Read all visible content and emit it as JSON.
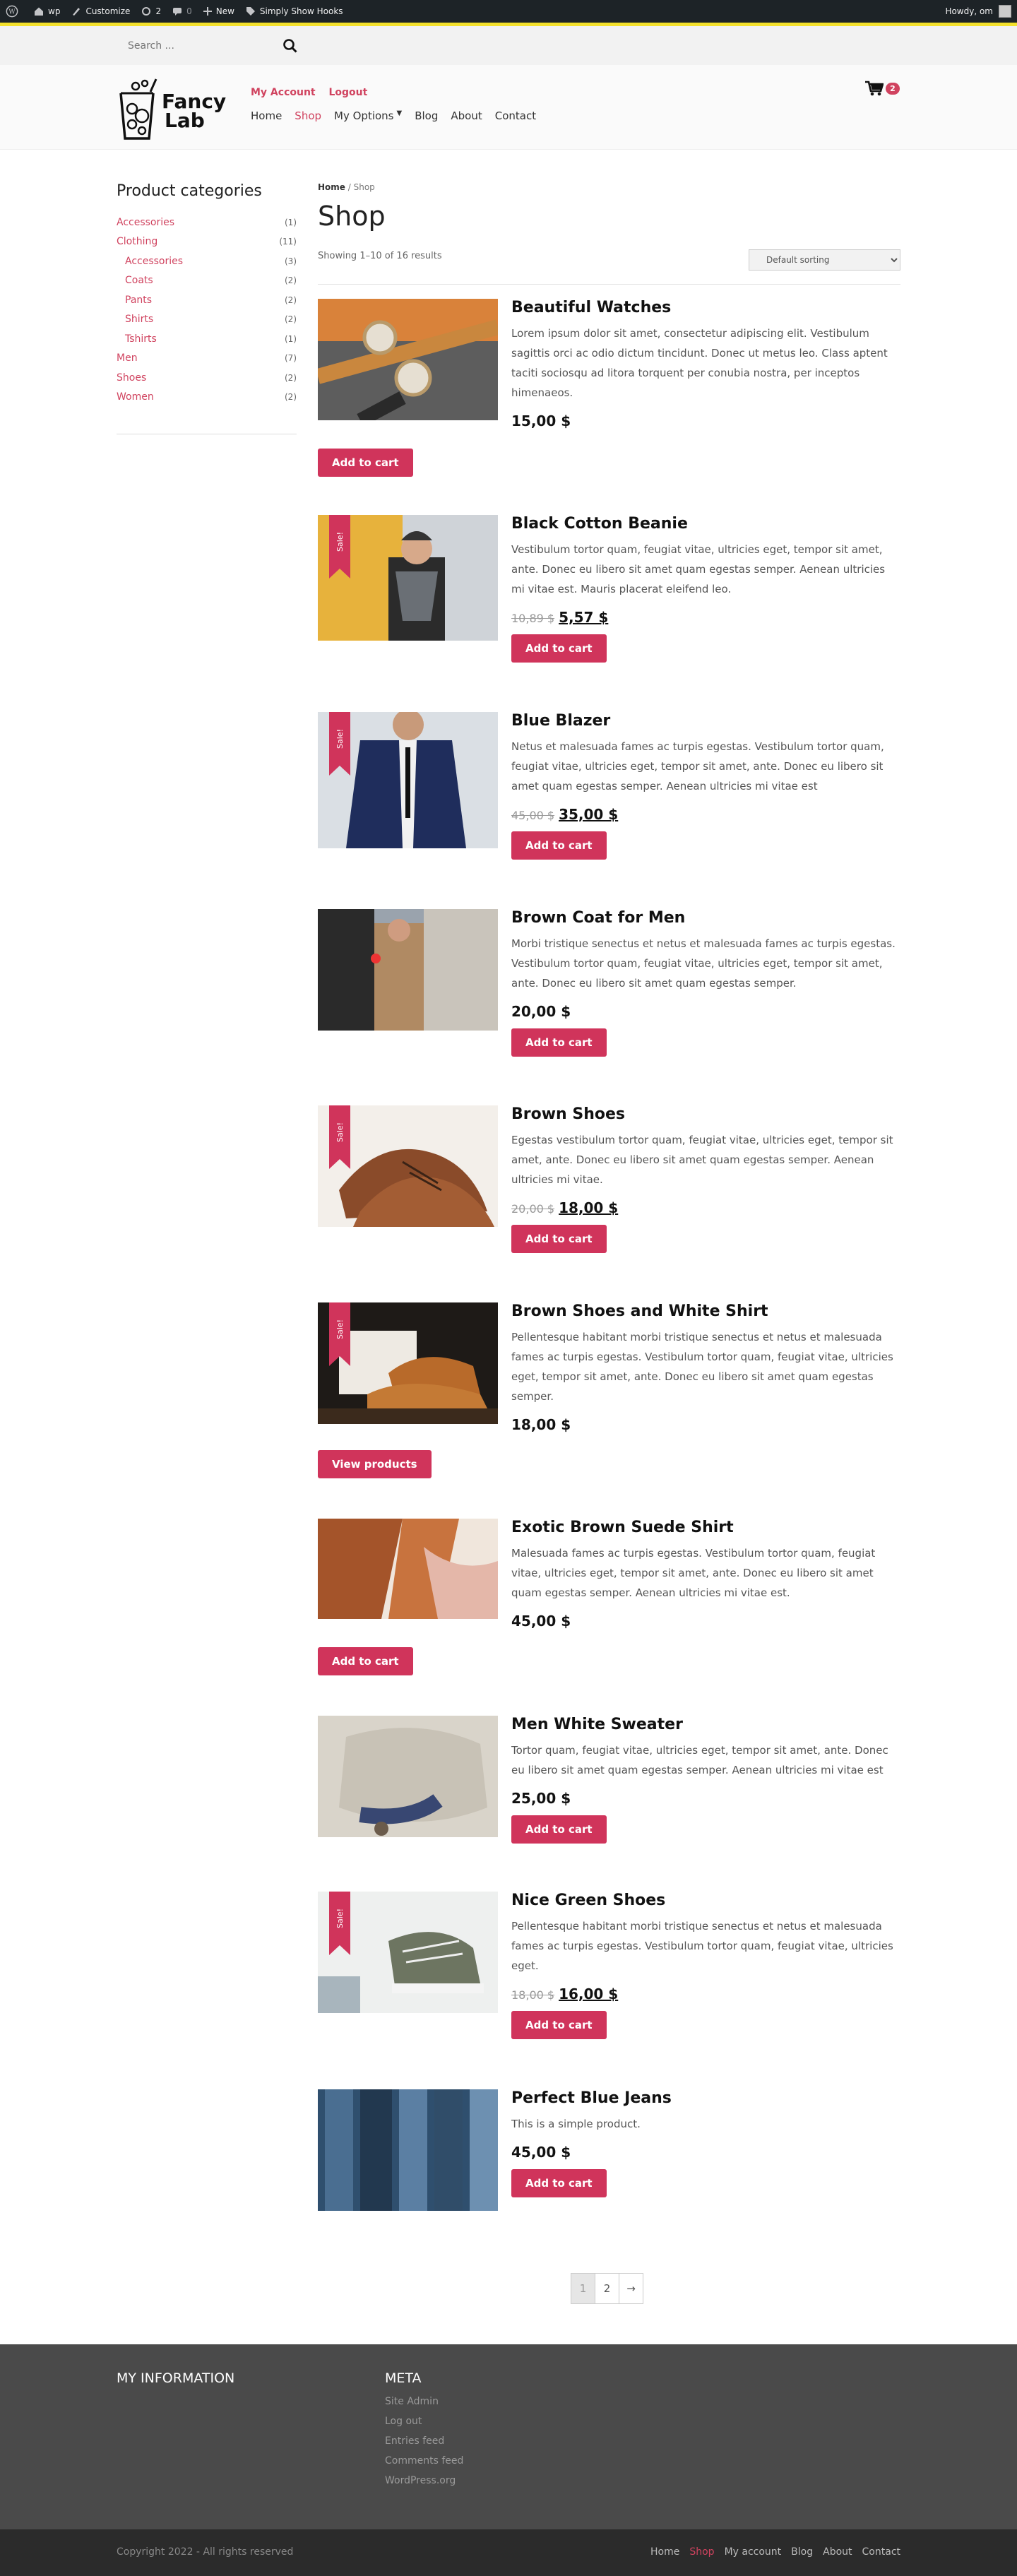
{
  "adminbar": {
    "site": "wp",
    "customize": "Customize",
    "updates": "2",
    "comments": "0",
    "new": "New",
    "plugin": "Simply Show Hooks",
    "howdy": "Howdy, om"
  },
  "search": {
    "placeholder": "Search ..."
  },
  "header": {
    "logo_line1": "Fancy",
    "logo_line2": "Lab",
    "my_account": "My Account",
    "logout": "Logout",
    "cart_count": "2",
    "nav": [
      "Home",
      "Shop",
      "My Options",
      "Blog",
      "About",
      "Contact"
    ],
    "active_nav": "Shop"
  },
  "sidebar": {
    "title": "Product categories",
    "categories": [
      {
        "name": "Accessories",
        "count": "(1)",
        "sub": false
      },
      {
        "name": "Clothing",
        "count": "(11)",
        "sub": false
      },
      {
        "name": "Accessories",
        "count": "(3)",
        "sub": true
      },
      {
        "name": "Coats",
        "count": "(2)",
        "sub": true
      },
      {
        "name": "Pants",
        "count": "(2)",
        "sub": true
      },
      {
        "name": "Shirts",
        "count": "(2)",
        "sub": true
      },
      {
        "name": "Tshirts",
        "count": "(1)",
        "sub": true
      },
      {
        "name": "Men",
        "count": "(7)",
        "sub": false
      },
      {
        "name": "Shoes",
        "count": "(2)",
        "sub": false
      },
      {
        "name": "Women",
        "count": "(2)",
        "sub": false
      }
    ]
  },
  "main": {
    "breadcrumb_home": "Home",
    "breadcrumb_sep": " / ",
    "breadcrumb_current": "Shop",
    "title": "Shop",
    "result_count": "Showing 1–10 of 16 results",
    "sort_selected": "Default sorting"
  },
  "products": [
    {
      "title": "Beautiful Watches",
      "desc": "Lorem ipsum dolor sit amet, consectetur adipiscing elit. Vestibulum sagittis orci ac odio dictum tincidunt. Donec ut metus leo. Class aptent taciti sociosqu ad litora torquent per conubia nostra, per inceptos himenaeos.",
      "old_price": "",
      "price": "15,00 $",
      "sale": false,
      "button": "Add to cart"
    },
    {
      "title": "Black Cotton Beanie",
      "desc": "Vestibulum tortor quam, feugiat vitae, ultricies eget, tempor sit amet, ante. Donec eu libero sit amet quam egestas semper. Aenean ultricies mi vitae est. Mauris placerat eleifend leo.",
      "old_price": "10,89 $",
      "price": "5,57 $",
      "sale": true,
      "button": "Add to cart"
    },
    {
      "title": "Blue Blazer",
      "desc": "Netus et malesuada fames ac turpis egestas. Vestibulum tortor quam, feugiat vitae, ultricies eget, tempor sit amet, ante. Donec eu libero sit amet quam egestas semper. Aenean ultricies mi vitae est",
      "old_price": "45,00 $",
      "price": "35,00 $",
      "sale": true,
      "button": "Add to cart"
    },
    {
      "title": "Brown Coat for Men",
      "desc": "Morbi tristique senectus et netus et malesuada fames ac turpis egestas. Vestibulum tortor quam, feugiat vitae, ultricies eget, tempor sit amet, ante. Donec eu libero sit amet quam egestas semper.",
      "old_price": "",
      "price": "20,00 $",
      "sale": false,
      "button": "Add to cart"
    },
    {
      "title": "Brown Shoes",
      "desc": "Egestas vestibulum tortor quam, feugiat vitae, ultricies eget, tempor sit amet, ante. Donec eu libero sit amet quam egestas semper. Aenean ultricies mi vitae.",
      "old_price": "20,00 $",
      "price": "18,00 $",
      "sale": true,
      "button": "Add to cart"
    },
    {
      "title": "Brown Shoes and White Shirt",
      "desc": "Pellentesque habitant morbi tristique senectus et netus et malesuada fames ac turpis egestas. Vestibulum tortor quam, feugiat vitae, ultricies eget, tempor sit amet, ante. Donec eu libero sit amet quam egestas semper.",
      "old_price": "",
      "price": "18,00 $",
      "sale": true,
      "button": "View products"
    },
    {
      "title": "Exotic Brown Suede Shirt",
      "desc": "Malesuada fames ac turpis egestas. Vestibulum tortor quam, feugiat vitae, ultricies eget, tempor sit amet, ante. Donec eu libero sit amet quam egestas semper. Aenean ultricies mi vitae est.",
      "old_price": "",
      "price": "45,00 $",
      "sale": false,
      "button": "Add to cart"
    },
    {
      "title": "Men White Sweater",
      "desc": "Tortor quam, feugiat vitae, ultricies eget, tempor sit amet, ante. Donec eu libero sit amet quam egestas semper. Aenean ultricies mi vitae est",
      "old_price": "",
      "price": "25,00 $",
      "sale": false,
      "button": "Add to cart"
    },
    {
      "title": "Nice Green Shoes",
      "desc": "Pellentesque habitant morbi tristique senectus et netus et malesuada fames ac turpis egestas. Vestibulum tortor quam, feugiat vitae, ultricies eget.",
      "old_price": "18,00 $",
      "price": "16,00 $",
      "sale": true,
      "button": "Add to cart"
    },
    {
      "title": "Perfect Blue Jeans",
      "desc": "This is a simple product.",
      "old_price": "",
      "price": "45,00 $",
      "sale": false,
      "button": "Add to cart"
    }
  ],
  "sale_label": "Sale!",
  "pagination": {
    "current": "1",
    "next": "2",
    "arrow": "→"
  },
  "footer": {
    "col1_title": "MY INFORMATION",
    "col2_title": "META",
    "meta_links": [
      "Site Admin",
      "Log out",
      "Entries feed",
      "Comments feed",
      "WordPress.org"
    ],
    "copyright": "Copyright 2022 - All rights reserved",
    "nav": [
      "Home",
      "Shop",
      "My account",
      "Blog",
      "About",
      "Contact"
    ],
    "active_nav": "Shop"
  },
  "colors": {
    "accent": "#d0345b",
    "adminbar": "#1d2327",
    "footer": "#4a4a4a",
    "footer_bottom": "#2b2b2b"
  }
}
